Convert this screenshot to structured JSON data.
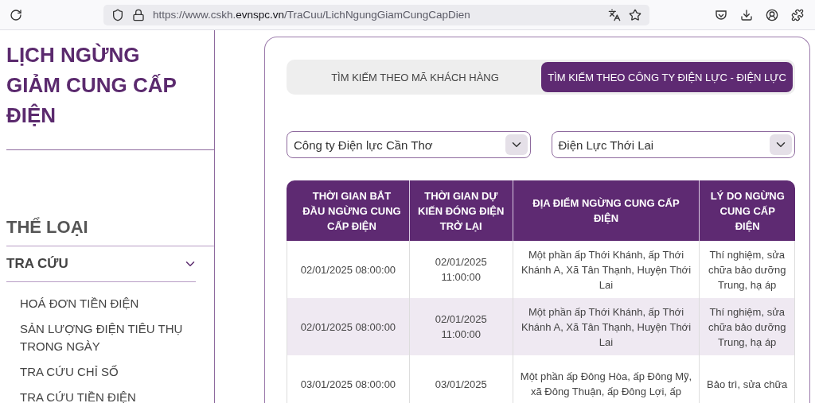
{
  "browser": {
    "url": {
      "prefix": "https://www.cskh.",
      "domain": "evnspc.vn",
      "path": "/TraCuu/LichNgungGiamCungCapDien"
    }
  },
  "sidebar": {
    "title": "LỊCH NGỪNG GIẢM CUNG CẤP ĐIỆN",
    "category_heading": "THỂ LOẠI",
    "groups": [
      {
        "label": "TRA CỨU",
        "expanded": true,
        "children": [
          {
            "label": "HOÁ ĐƠN TIỀN ĐIỆN"
          },
          {
            "label": "SẢN LƯỢNG ĐIỆN TIÊU THỤ TRONG NGÀY"
          },
          {
            "label": "TRA CỨU CHỈ SỐ"
          },
          {
            "label": "TRA CỨU TIỀN ĐIỆN"
          }
        ]
      }
    ]
  },
  "tabs": [
    {
      "label": "TÌM KIẾM THEO MÃ KHÁCH HÀNG",
      "selected": false
    },
    {
      "label": "TÌM KIẾM THEO CÔNG TY ĐIỆN LỰC - ĐIỆN LỰC",
      "selected": true
    }
  ],
  "filters": [
    {
      "value": "Công ty Điện lực Cần Thơ"
    },
    {
      "value": "Điện Lực Thới Lai"
    }
  ],
  "table": {
    "columns": [
      "THỜI GIAN BẮT ĐẦU NGỪNG CUNG CẤP ĐIỆN",
      "THỜI GIAN DỰ KIẾN ĐÓNG ĐIỆN TRỞ LẠI",
      "ĐỊA ĐIỂM NGỪNG CUNG CẤP ĐIỆN",
      "LÝ DO NGỪNG CUNG CẤP ĐIỆN"
    ],
    "rows": [
      [
        "02/01/2025 08:00:00",
        "02/01/2025 11:00:00",
        "Một phần ấp Thới Khánh, ấp Thới Khánh A, Xã Tân Thạnh, Huyện Thới Lai",
        "Thí nghiệm, sửa chữa bảo dưỡng Trung, hạ áp"
      ],
      [
        "02/01/2025 08:00:00",
        "02/01/2025 11:00:00",
        "Một phần ấp Thới Khánh, ấp Thới Khánh A, Xã Tân Thạnh, Huyện Thới Lai",
        "Thí nghiệm, sửa chữa bảo dưỡng Trung, hạ áp"
      ],
      [
        "03/01/2025 08:00:00",
        "03/01/2025",
        "Một phần ấp Đông Hòa, ấp Đông Mỹ, xã Đông Thuận, ấp Đông Lợi, ấp",
        "Bảo trì, sửa chữa"
      ]
    ]
  }
}
